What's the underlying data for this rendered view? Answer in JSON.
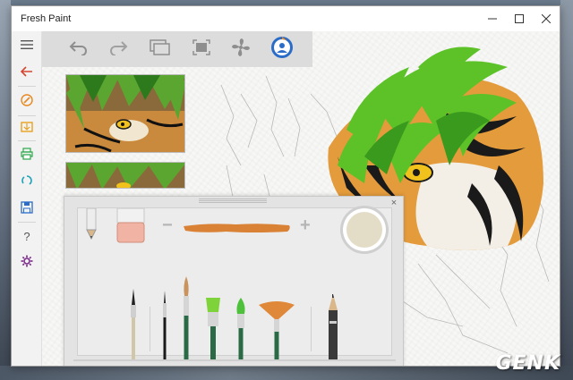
{
  "window": {
    "title": "Fresh Paint"
  },
  "titlebar_icons": [
    "minimize-icon",
    "maximize-icon",
    "close-icon"
  ],
  "sidebar": {
    "items": [
      {
        "name": "hamburger-menu",
        "icon": "menu-icon"
      },
      {
        "name": "back",
        "icon": "back-arrow-icon"
      },
      {
        "name": "paint-tools",
        "icon": "brush-icon"
      },
      {
        "name": "import-photo",
        "icon": "import-icon"
      },
      {
        "name": "print",
        "icon": "print-icon"
      },
      {
        "name": "share",
        "icon": "share-icon"
      },
      {
        "name": "save",
        "icon": "save-icon"
      },
      {
        "name": "help",
        "icon": "help-icon",
        "label": "?"
      },
      {
        "name": "settings",
        "icon": "gear-icon"
      }
    ]
  },
  "toolbar": {
    "icons": [
      "undo-icon",
      "redo-icon",
      "layers-icon",
      "fit-screen-icon",
      "fan-dry-icon",
      "artist-avatar-icon"
    ]
  },
  "tray": {
    "minus_label": "−",
    "plus_label": "+",
    "close_label": "×",
    "tools": [
      "pencil",
      "eraser",
      "paint-stroke-preview",
      "color-swatch",
      "pencil-brush",
      "thin-brush",
      "round-brush",
      "flat-brush-green",
      "round-brush-green",
      "fan-brush",
      "graphite-pencil"
    ]
  },
  "colors": {
    "accent": "#d64633",
    "sidebar_accent": "#e8871e",
    "brush_stroke": "#d98236",
    "swatch": "#e3dcc6"
  },
  "watermark": {
    "text": "GENK"
  }
}
